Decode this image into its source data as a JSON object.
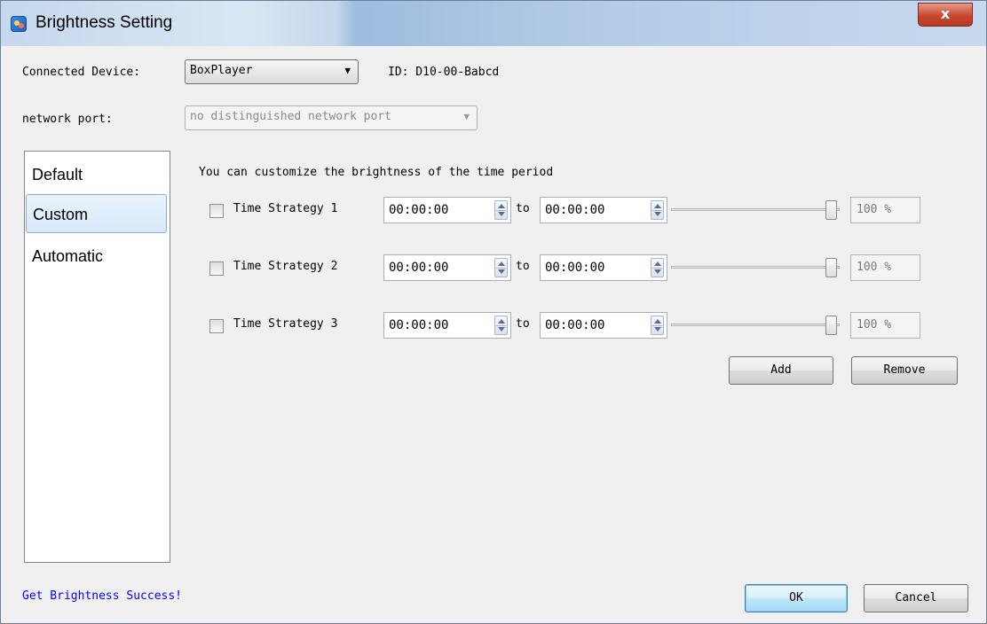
{
  "window": {
    "title": "Brightness Setting",
    "close_glyph": "x"
  },
  "device": {
    "label": "Connected Device:",
    "selected": "BoxPlayer",
    "id_text": "ID: D10-00-Babcd"
  },
  "network": {
    "label": "network port:",
    "selected": "no distinguished network port"
  },
  "sidebar": {
    "items": [
      {
        "label": "Default",
        "selected": false
      },
      {
        "label": "Custom",
        "selected": true
      },
      {
        "label": "Automatic",
        "selected": false
      }
    ]
  },
  "custom": {
    "description": "You can customize the brightness of the time period",
    "to_label": "to",
    "strategies": [
      {
        "label": "Time Strategy 1",
        "checked": false,
        "from": "00:00:00",
        "to": "00:00:00",
        "level_percent": 100,
        "percent_text": "100 %"
      },
      {
        "label": "Time Strategy 2",
        "checked": false,
        "from": "00:00:00",
        "to": "00:00:00",
        "level_percent": 100,
        "percent_text": "100 %"
      },
      {
        "label": "Time Strategy 3",
        "checked": false,
        "from": "00:00:00",
        "to": "00:00:00",
        "level_percent": 100,
        "percent_text": "100 %"
      }
    ],
    "add_label": "Add",
    "remove_label": "Remove"
  },
  "footer": {
    "status": "Get Brightness Success!",
    "ok_label": "OK",
    "cancel_label": "Cancel"
  },
  "colors": {
    "status_text": "#0000ff",
    "selected_item_border": "#84acdd",
    "close_button": "#c9472f"
  }
}
